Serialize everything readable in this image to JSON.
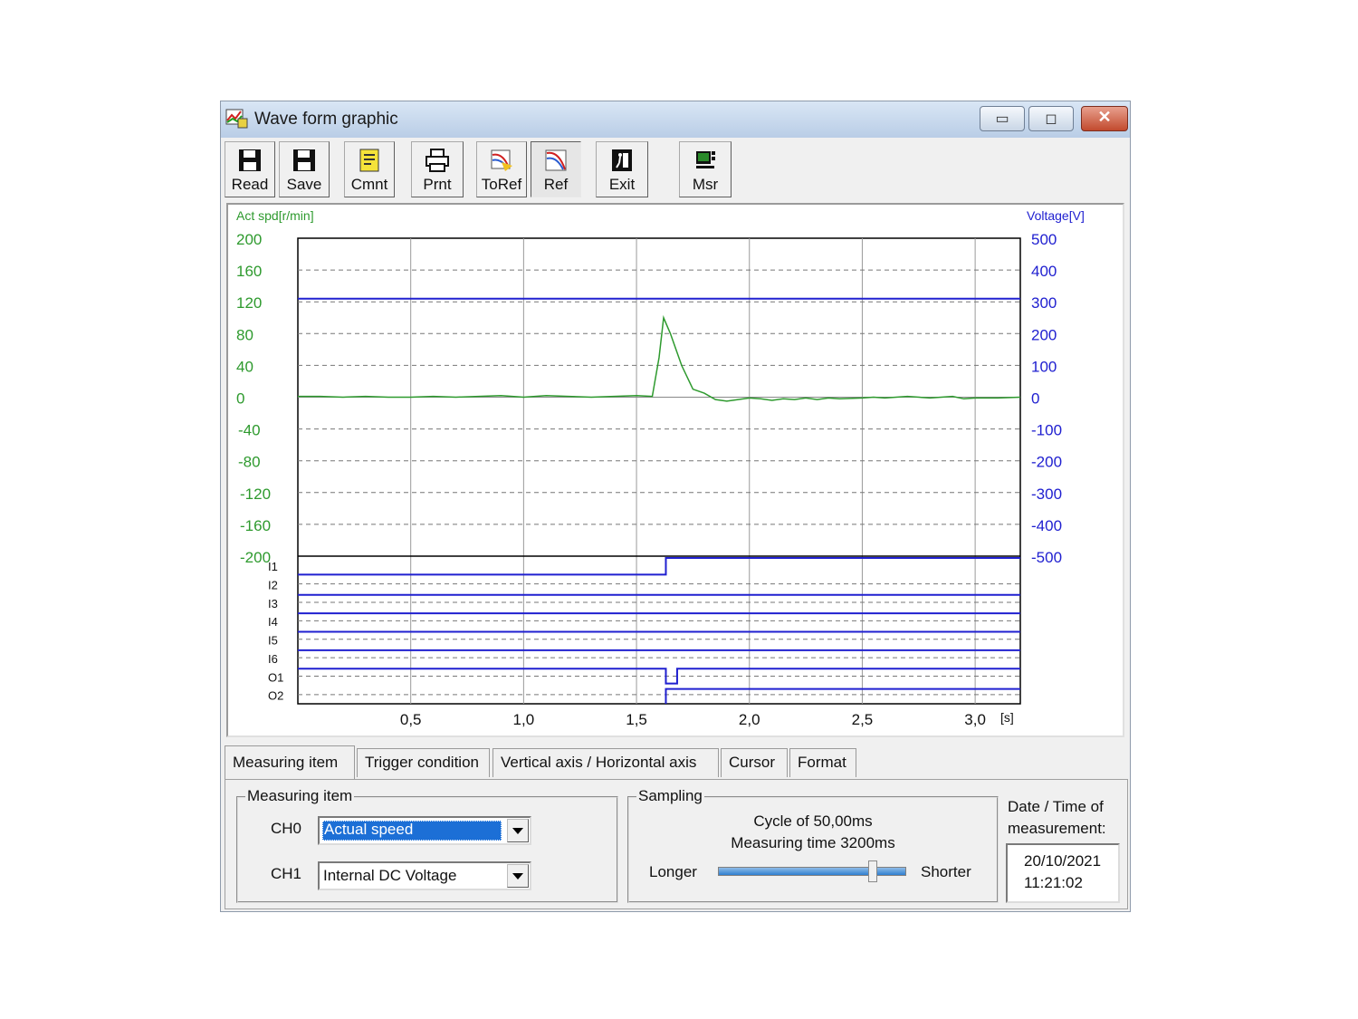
{
  "window": {
    "title": "Wave form graphic",
    "controls": [
      "minimize",
      "maximize",
      "close"
    ]
  },
  "toolbar": [
    {
      "label": "Read",
      "icon": "floppy-icon"
    },
    {
      "label": "Save",
      "icon": "floppy-icon"
    },
    {
      "label": "Cmnt",
      "icon": "note-icon"
    },
    {
      "label": "Prnt",
      "icon": "printer-icon"
    },
    {
      "label": "ToRef",
      "icon": "to-reference-icon"
    },
    {
      "label": "Ref",
      "icon": "reference-icon",
      "pressed": true
    },
    {
      "label": "Exit",
      "icon": "exit-icon"
    },
    {
      "label": "Msr",
      "icon": "measure-icon"
    }
  ],
  "chart_data": {
    "type": "line",
    "left_axis": {
      "label": "Act spd[r/min]",
      "ticks": [
        "200",
        "160",
        "120",
        "80",
        "40",
        "0",
        "-40",
        "-80",
        "-120",
        "-160",
        "-200"
      ],
      "range": [
        -200,
        200
      ],
      "color": "#2e9a2e"
    },
    "right_axis": {
      "label": "Voltage[V]",
      "ticks": [
        "500",
        "400",
        "300",
        "200",
        "100",
        "0",
        "-100",
        "-200",
        "-300",
        "-400",
        "-500"
      ],
      "range": [
        -500,
        500
      ],
      "color": "#2020d0"
    },
    "x_axis": {
      "ticks": [
        "0,5",
        "1,0",
        "1,5",
        "2,0",
        "2,5",
        "3,0"
      ],
      "unit": "[s]",
      "range": [
        0,
        3.2
      ]
    },
    "series": [
      {
        "axis": "left",
        "color": "#2e9a2e",
        "x": [
          0,
          0.1,
          0.2,
          0.3,
          0.4,
          0.5,
          0.6,
          0.7,
          0.8,
          0.9,
          1.0,
          1.1,
          1.2,
          1.3,
          1.4,
          1.5,
          1.57,
          1.6,
          1.62,
          1.65,
          1.7,
          1.75,
          1.8,
          1.85,
          1.9,
          1.95,
          2.0,
          2.05,
          2.1,
          2.15,
          2.2,
          2.25,
          2.3,
          2.35,
          2.4,
          2.5,
          2.55,
          2.6,
          2.7,
          2.8,
          2.9,
          2.95,
          3.0,
          3.1,
          3.2
        ],
        "y": [
          1,
          1,
          0,
          1,
          0,
          0,
          1,
          0,
          1,
          2,
          0,
          2,
          1,
          0,
          1,
          2,
          1,
          50,
          100,
          80,
          40,
          10,
          5,
          -3,
          -5,
          -3,
          -1,
          -2,
          -4,
          -2,
          -3,
          -1,
          -3,
          -1,
          -2,
          -1,
          0,
          -1,
          1,
          -1,
          1,
          -2,
          -1,
          -1,
          0
        ]
      },
      {
        "axis": "right",
        "color": "#2020d0",
        "x": [
          0,
          3.2
        ],
        "y": [
          310,
          310
        ]
      }
    ],
    "digital": {
      "labels": [
        "I1",
        "I2",
        "I3",
        "I4",
        "I5",
        "I6",
        "O1",
        "O2"
      ],
      "transition_x": 1.63,
      "pulse_end_x": 1.68
    },
    "grid": true
  },
  "tabs": [
    "Measuring item",
    "Trigger condition",
    "Vertical axis / Horizontal axis",
    "Cursor",
    "Format"
  ],
  "measuring": {
    "legend": "Measuring item",
    "ch0_label": "CH0",
    "ch0_value": "Actual speed",
    "ch1_label": "CH1",
    "ch1_value": "Internal DC Voltage"
  },
  "sampling": {
    "legend": "Sampling",
    "cycle": "Cycle of 50,00ms",
    "measuring_time": "Measuring time 3200ms",
    "longer": "Longer",
    "shorter": "Shorter",
    "slider_level": 0.82
  },
  "datetime": {
    "label_line1": "Date / Time of",
    "label_line2": "measurement:",
    "date": "20/10/2021",
    "time": "11:21:02"
  }
}
